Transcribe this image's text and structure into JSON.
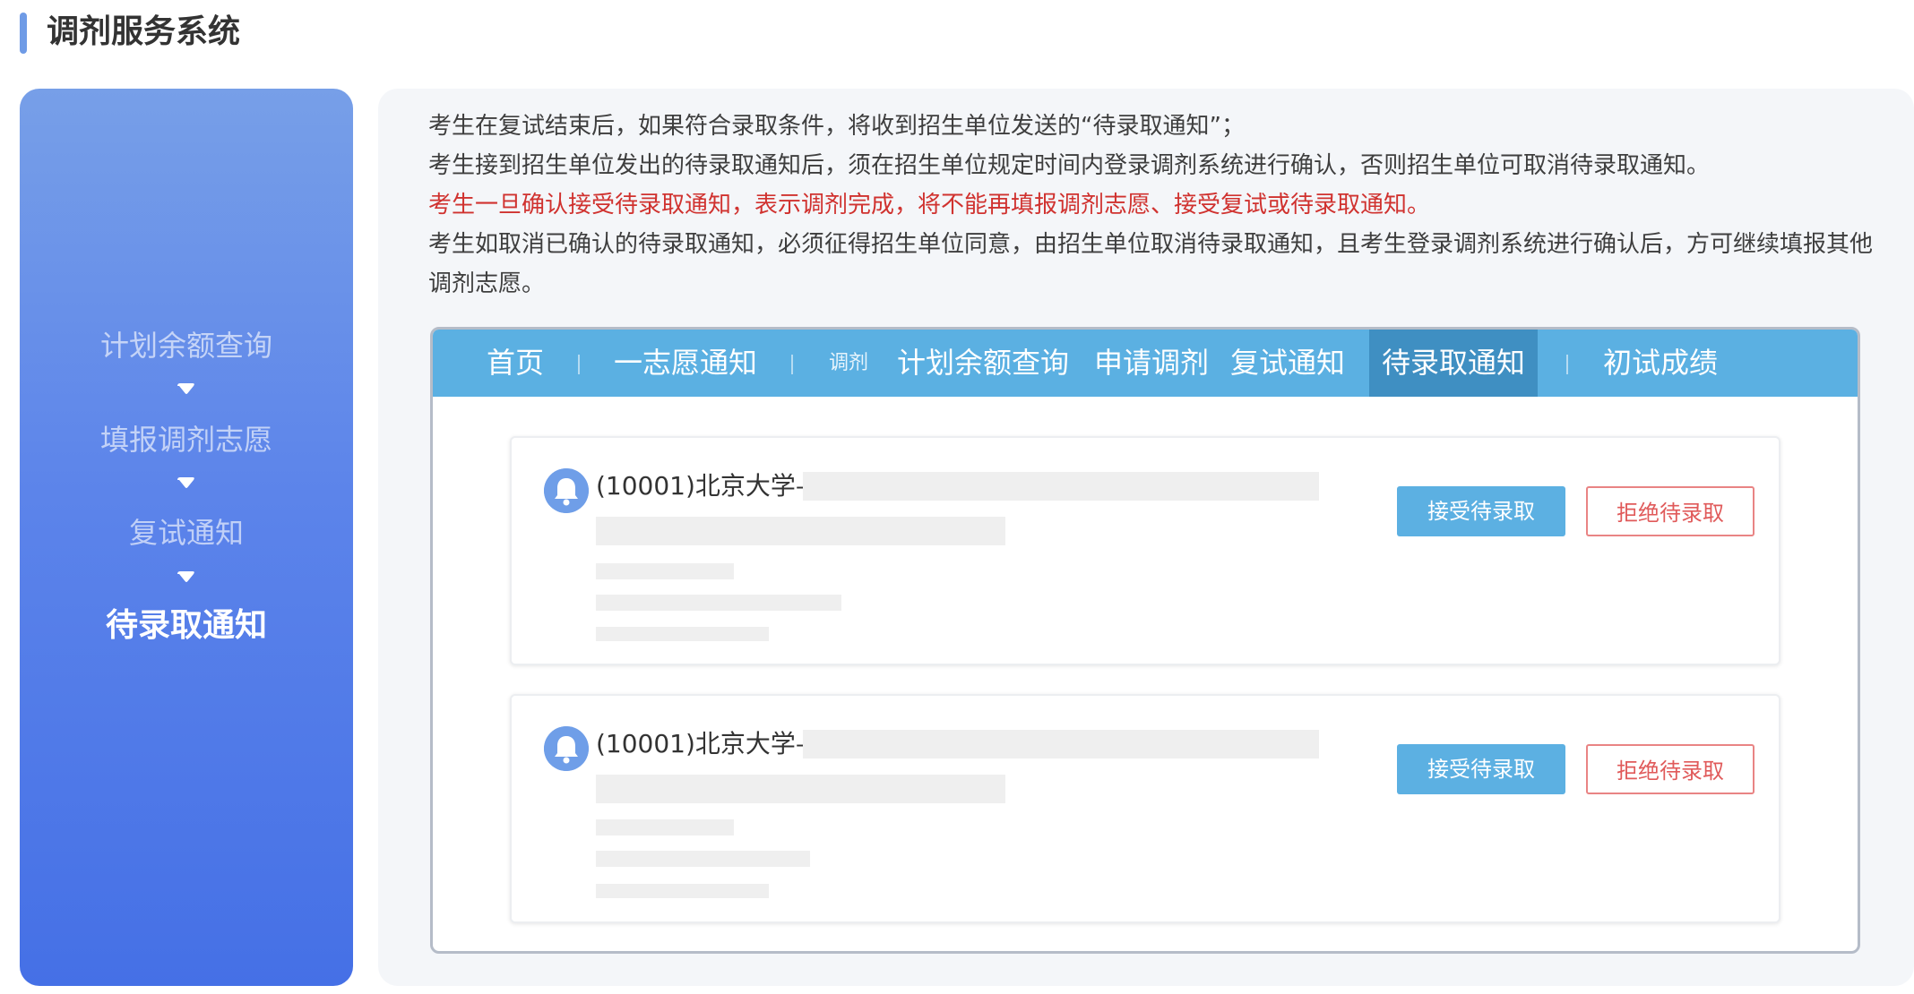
{
  "header": {
    "title": "调剂服务系统"
  },
  "sidebar": {
    "steps": [
      {
        "label": "计划余额查询"
      },
      {
        "label": "填报调剂志愿"
      },
      {
        "label": "复试通知"
      },
      {
        "label": "待录取通知"
      }
    ],
    "active_index": 3
  },
  "main": {
    "description": [
      "考生在复试结束后，如果符合录取条件，将收到招生单位发送的“待录取通知”；",
      "考生接到招生单位发出的待录取通知后，须在招生单位规定时间内登录调剂系统进行确认，否则招生单位可取消待录取通知。",
      "考生一旦确认接受待录取通知，表示调剂完成，将不能再填报调剂志愿、接受复试或待录取通知。",
      "考生如取消已确认的待录取通知，必须征得招生单位同意，由招生单位取消待录取通知，且考生登录调剂系统进行确认后，方可继续填报其他调剂志愿。"
    ],
    "warning_color": "#d0322f"
  },
  "frame": {
    "nav": [
      {
        "label": "首页"
      },
      {
        "label": "一志愿通知"
      },
      {
        "label": "调剂"
      },
      {
        "label": "计划余额查询"
      },
      {
        "label": "申请调剂"
      },
      {
        "label": "复试通知"
      },
      {
        "label": "待录取通知"
      },
      {
        "label": "初试成绩"
      }
    ],
    "active_nav": "待录取通知",
    "notices": [
      {
        "school": "(10001)北京大学–",
        "accept_label": "接受待录取",
        "reject_label": "拒绝待录取"
      },
      {
        "school": "(10001)北京大学–",
        "accept_label": "接受待录取",
        "reject_label": "拒绝待录取"
      }
    ]
  },
  "colors": {
    "accent": "#5b84ea",
    "nav_bar": "#5bb0e2",
    "accept_button": "#5cb0e2",
    "reject_text": "#e05a5a"
  },
  "icons": {
    "bell": "bell-icon",
    "step_arrow": "caret-down-icon",
    "header_marker": "title-bar-accent"
  }
}
